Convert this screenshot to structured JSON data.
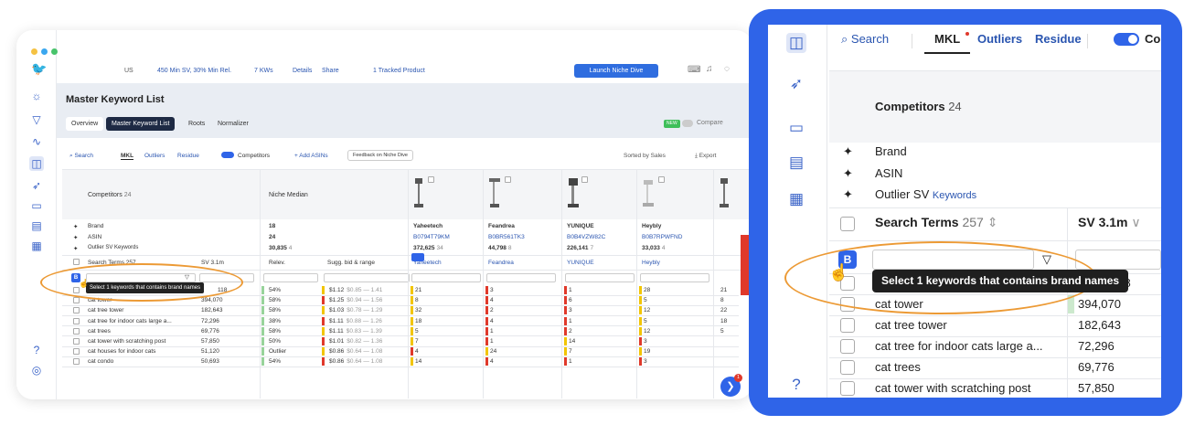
{
  "left": {
    "topbar": {
      "marketplace": "US",
      "filters": "450 Min SV, 30% Min Rel.",
      "kws": "7 KWs",
      "details": "Details",
      "share": "Share",
      "tracked": "1 Tracked Product",
      "launch": "Launch Niche Dive"
    },
    "title": "Master Keyword List",
    "tabs": [
      "Overview",
      "Master Keyword List",
      "Roots",
      "Normalizer"
    ],
    "new_badge": "NEW",
    "compare": "Compare",
    "subtabs": {
      "search": "Search",
      "mkl": "MKL",
      "outliers": "Outliers",
      "residue": "Residue",
      "competitors": "Competitors",
      "add_asins": "+ Add ASINs",
      "feedback": "Feedback on Niche Dive",
      "sorted": "Sorted by Sales",
      "export": "Export"
    },
    "header": {
      "competitors": "Competitors",
      "competitors_count": "24",
      "niche_median": "Niche Median"
    },
    "pinned_rows": [
      "Brand",
      "ASIN",
      "Outlier SV Keywords"
    ],
    "median_values": [
      "18",
      "24",
      "30,835"
    ],
    "median_sub": "4",
    "columns": {
      "search_terms": "Search Terms 257",
      "sv": "SV 3.1m",
      "relev": "Relev.",
      "sugg": "Sugg. bid & range"
    },
    "products": [
      {
        "brand": "Yaheetech",
        "asin": "B0794T79KM",
        "sv": "372,625",
        "sv_sub": "34",
        "name": "Yaheetech"
      },
      {
        "brand": "Feandrea",
        "asin": "B0BR561TK3",
        "sv": "44,798",
        "sv_sub": "8",
        "name": "Feandrea"
      },
      {
        "brand": "YUNIQUE",
        "asin": "B0B4VZW82C",
        "sv": "226,141",
        "sv_sub": "7",
        "name": "YUNIQUE"
      },
      {
        "brand": "Heybly",
        "asin": "B0B7RPWFND",
        "sv": "33,033",
        "sv_sub": "4",
        "name": "Heybly"
      }
    ],
    "tooltip": "Select 1 keywords that contains brand names",
    "rows": [
      {
        "term": "",
        "sv": "118",
        "rel": "54%",
        "bid": "$1.12",
        "range": "$0.85 — 1.41",
        "p": [
          "21",
          "3",
          "1",
          "28"
        ]
      },
      {
        "term": "cat tower",
        "sv": "394,070",
        "rel": "58%",
        "bid": "$1.25",
        "range": "$0.94 — 1.56",
        "p": [
          "8",
          "4",
          "6",
          "5"
        ]
      },
      {
        "term": "cat tree tower",
        "sv": "182,643",
        "rel": "58%",
        "bid": "$1.03",
        "range": "$0.78 — 1.29",
        "p": [
          "32",
          "2",
          "3",
          "12"
        ]
      },
      {
        "term": "cat tree for indoor cats large a...",
        "sv": "72,296",
        "rel": "38%",
        "bid": "$1.11",
        "range": "$0.88 — 1.26",
        "p": [
          "18",
          "4",
          "1",
          "5"
        ]
      },
      {
        "term": "cat trees",
        "sv": "69,776",
        "rel": "58%",
        "bid": "$1.11",
        "range": "$0.83 — 1.39",
        "p": [
          "5",
          "1",
          "2",
          "12"
        ]
      },
      {
        "term": "cat tower with scratching post",
        "sv": "57,850",
        "rel": "50%",
        "bid": "$1.01",
        "range": "$0.82 — 1.36",
        "p": [
          "7",
          "1",
          "14",
          "3"
        ]
      },
      {
        "term": "cat houses for indoor cats",
        "sv": "51,120",
        "rel": "Outlier",
        "bid": "$0.86",
        "range": "$0.64 — 1.08",
        "p": [
          "4",
          "24",
          "7",
          "19"
        ]
      },
      {
        "term": "cat condo",
        "sv": "50,693",
        "rel": "54%",
        "bid": "$0.86",
        "range": "$0.64 — 1.08",
        "p": [
          "14",
          "4",
          "1",
          "3"
        ]
      }
    ],
    "extra_col": [
      "21",
      "8",
      "22",
      "18",
      "5"
    ],
    "feedback_tab": "Feedback",
    "chat_badge": "1",
    "brand_button": "B"
  },
  "right": {
    "tabs": {
      "search": "Search",
      "mkl": "MKL",
      "outliers": "Outliers",
      "residue": "Residue",
      "competitors": "Co"
    },
    "competitors": "Competitors",
    "competitors_count": "24",
    "pinned_rows": [
      "Brand",
      "ASIN",
      "Outlier SV"
    ],
    "keywords_suffix": "Keywords",
    "search_terms": "Search Terms",
    "search_terms_count": "257",
    "sv_header": "SV 3.1m",
    "brand_button": "B",
    "tooltip": "Select 1 keywords that contains brand names",
    "rows": [
      {
        "term": "",
        "sv": "118"
      },
      {
        "term": "cat tower",
        "sv": "394,070"
      },
      {
        "term": "cat tree tower",
        "sv": "182,643"
      },
      {
        "term": "cat tree for indoor cats large a...",
        "sv": "72,296"
      },
      {
        "term": "cat trees",
        "sv": "69,776"
      },
      {
        "term": "cat tower with scratching post",
        "sv": "57,850"
      }
    ]
  },
  "colors": {
    "accent": "#2f64e8",
    "highlight": "#ec9a35",
    "red": "#e0392b",
    "yellow": "#f2c500",
    "green": "#6cc070"
  }
}
